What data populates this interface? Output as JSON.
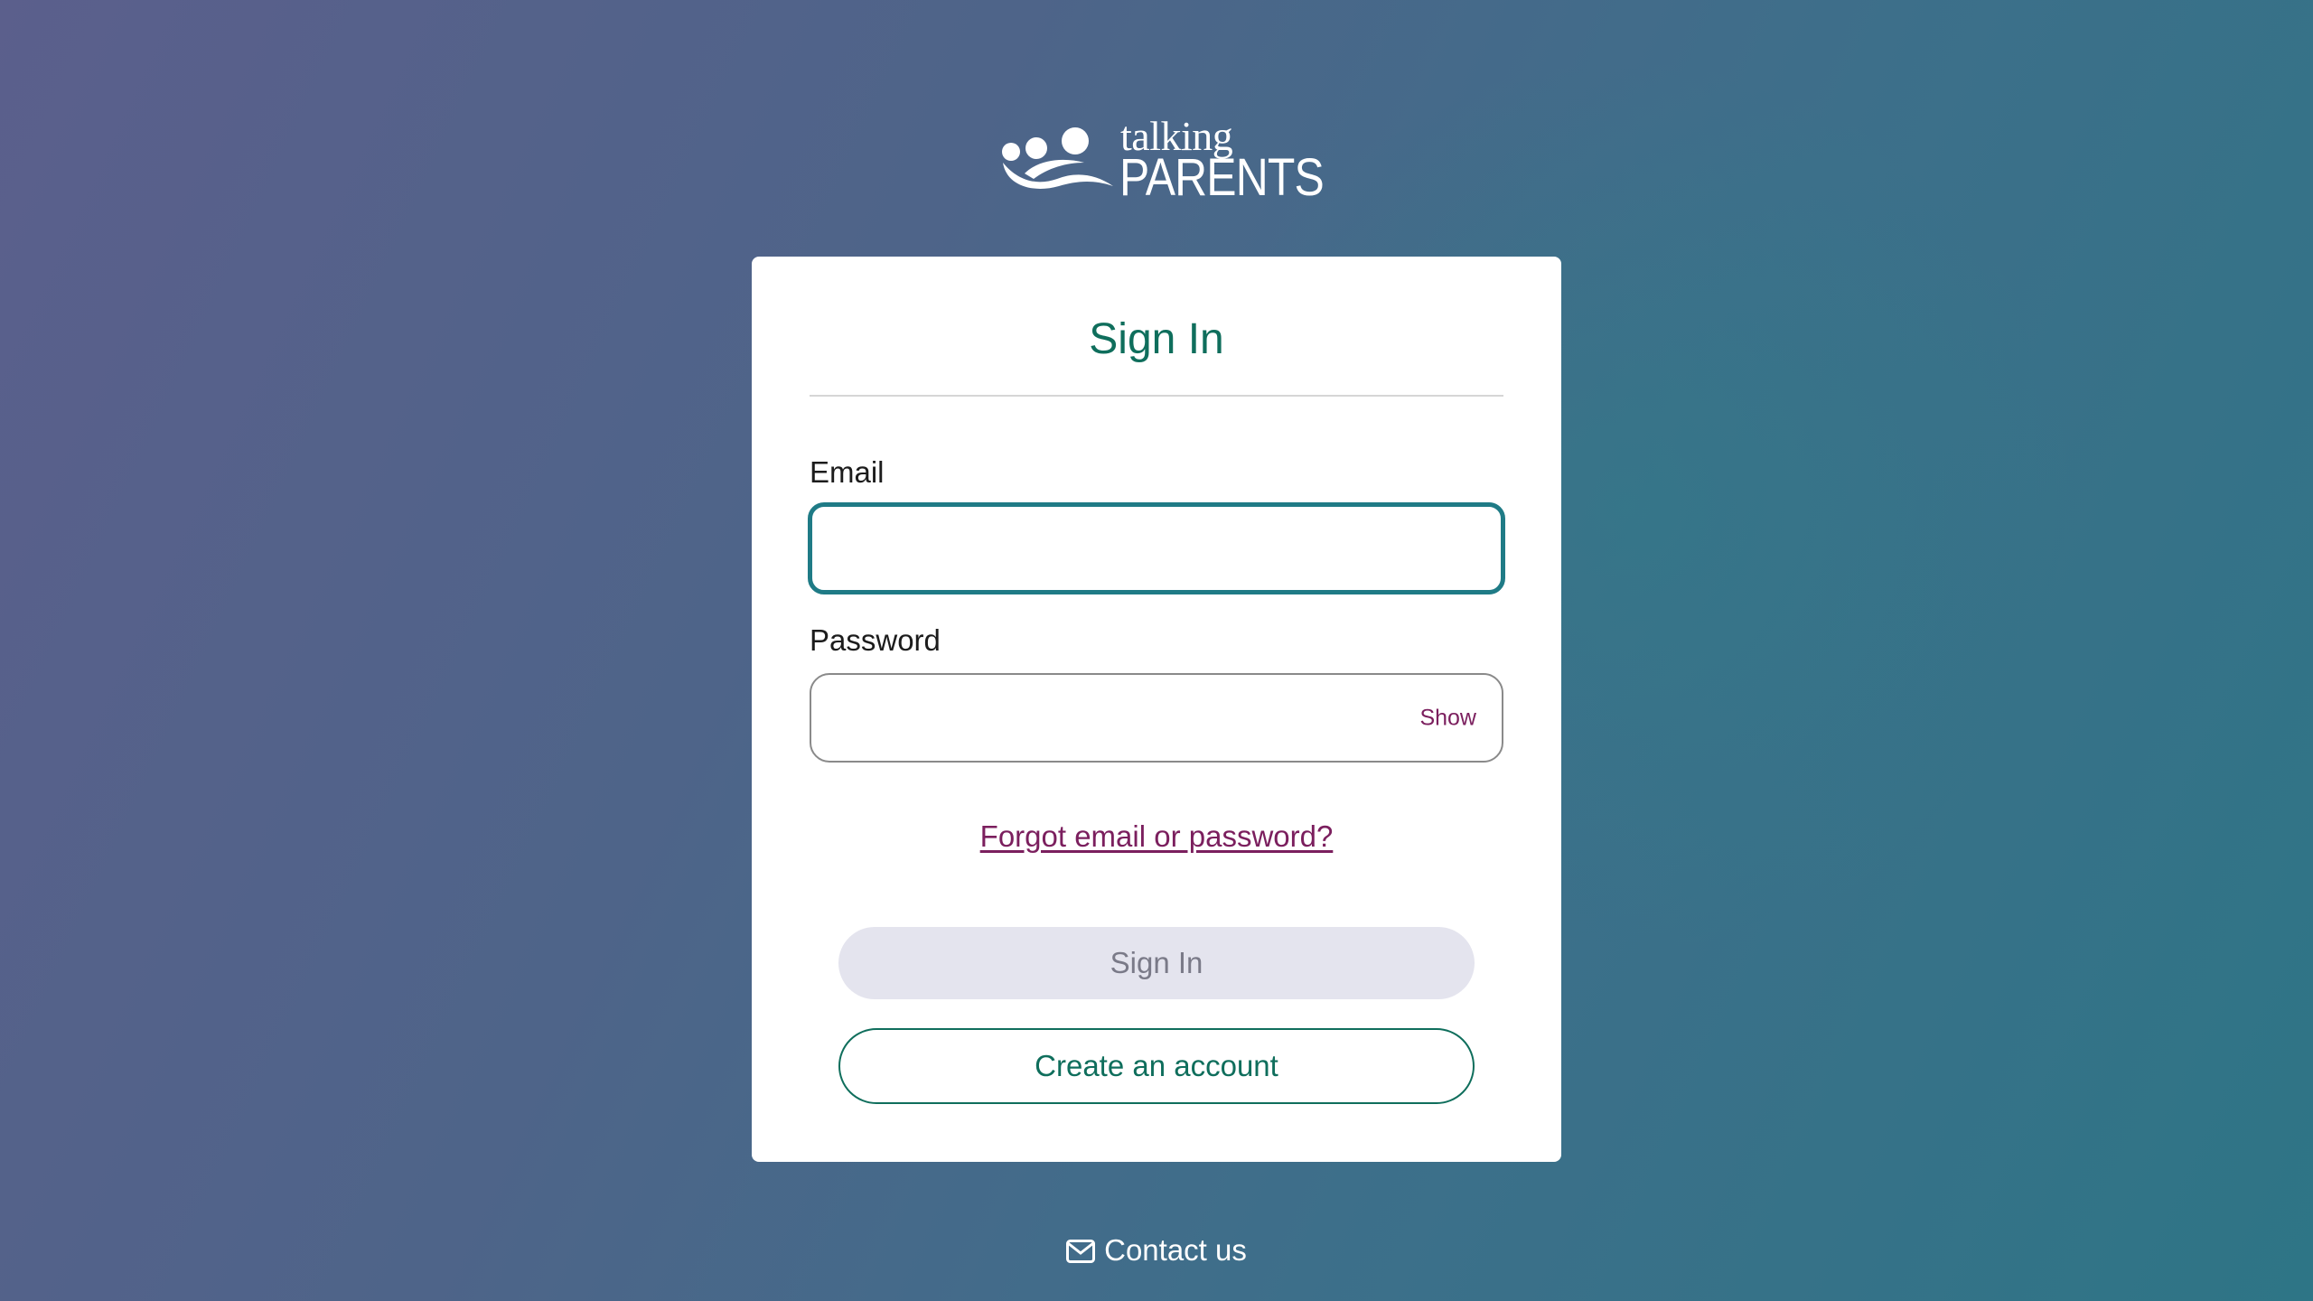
{
  "brand": {
    "logo_top": "talking",
    "logo_bottom": "PARENTS",
    "logo_icon": "people-icon"
  },
  "signin": {
    "title": "Sign In",
    "email_label": "Email",
    "email_value": "",
    "email_placeholder": "",
    "password_label": "Password",
    "password_value": "",
    "password_placeholder": "",
    "show_label": "Show",
    "forgot_link": "Forgot email or password?",
    "signin_button": "Sign In",
    "create_account_button": "Create an account"
  },
  "footer": {
    "contact_icon": "envelope-icon",
    "contact_label": "Contact us"
  },
  "colors": {
    "accent_green": "#0f6e5c",
    "link_magenta": "#7b1f5e",
    "focus_teal": "#1f7b86",
    "disabled_button": "#e4e4ee"
  }
}
